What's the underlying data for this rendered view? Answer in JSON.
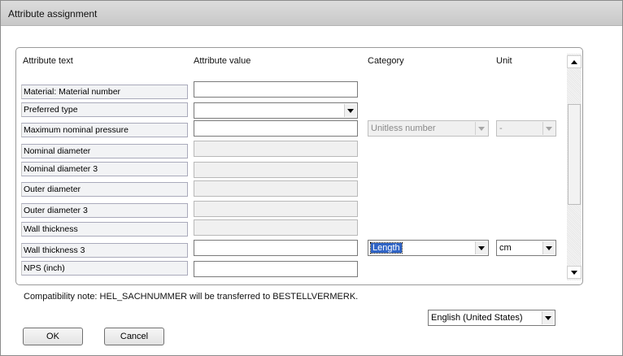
{
  "window": {
    "title": "Attribute assignment"
  },
  "table": {
    "headers": {
      "attribute_text": "Attribute text",
      "attribute_value": "Attribute value",
      "category": "Category",
      "unit": "Unit"
    },
    "rows": [
      {
        "label": "Material: Material number",
        "value": "",
        "value_kind": "text",
        "enabled": true
      },
      {
        "label": "Preferred type",
        "value": "",
        "value_kind": "dropdown",
        "enabled": true
      },
      {
        "label": "Maximum nominal pressure",
        "value": "",
        "value_kind": "text",
        "enabled": true,
        "category": "Unitless number",
        "category_enabled": false,
        "unit": "-",
        "unit_enabled": false
      },
      {
        "label": "Nominal diameter",
        "value": "",
        "value_kind": "text",
        "enabled": false
      },
      {
        "label": "Nominal diameter 3",
        "value": "",
        "value_kind": "text",
        "enabled": false
      },
      {
        "label": "Outer diameter",
        "value": "",
        "value_kind": "text",
        "enabled": false
      },
      {
        "label": "Outer diameter 3",
        "value": "",
        "value_kind": "text",
        "enabled": false
      },
      {
        "label": "Wall thickness",
        "value": "",
        "value_kind": "text",
        "enabled": false
      },
      {
        "label": "Wall thickness 3",
        "value": "",
        "value_kind": "text",
        "enabled": true,
        "category": "Length",
        "category_enabled": true,
        "category_selected": true,
        "unit": "cm",
        "unit_enabled": true
      },
      {
        "label": "NPS (inch)",
        "value": "",
        "value_kind": "text",
        "enabled": true
      }
    ]
  },
  "compatibility_note": "Compatibility note: HEL_SACHNUMMER will be transferred to BESTELLVERMERK.",
  "language_select": {
    "value": "English (United States)"
  },
  "buttons": {
    "ok": "OK",
    "cancel": "Cancel"
  },
  "colors": {
    "selection": "#3064c5",
    "title_bar": "#cccccc"
  }
}
